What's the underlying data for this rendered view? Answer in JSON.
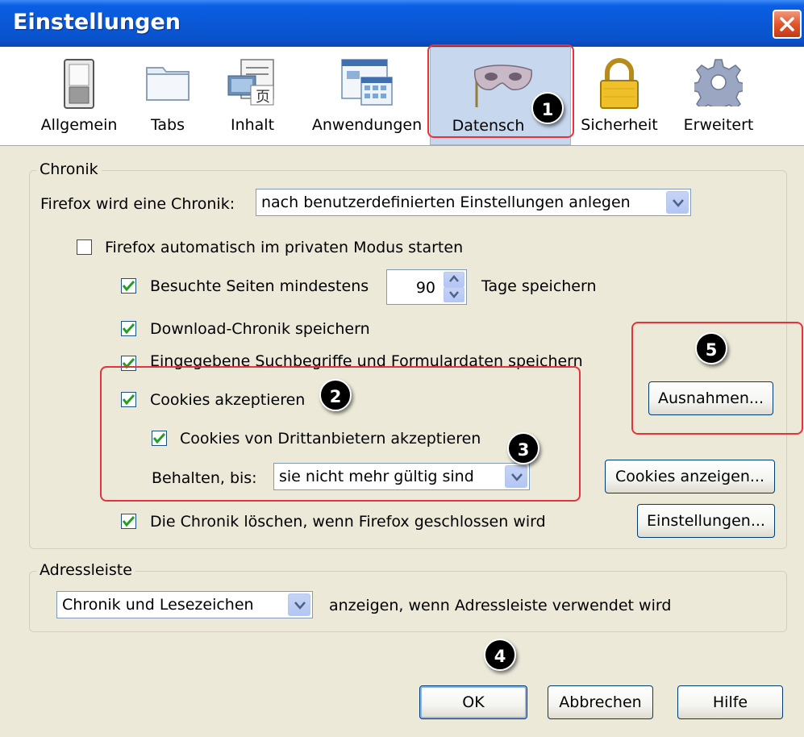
{
  "window": {
    "title": "Einstellungen"
  },
  "toolbar": {
    "panes": [
      {
        "label": "Allgemein",
        "icon": "switch-icon"
      },
      {
        "label": "Tabs",
        "icon": "folder-icon"
      },
      {
        "label": "Inhalt",
        "icon": "content-icon"
      },
      {
        "label": "Anwendungen",
        "icon": "applications-icon"
      },
      {
        "label": "Datensch",
        "icon": "mask-icon",
        "selected": true
      },
      {
        "label": "Sicherheit",
        "icon": "lock-icon"
      },
      {
        "label": "Erweitert",
        "icon": "gear-icon"
      }
    ]
  },
  "history": {
    "legend": "Chronik",
    "mode_label": "Firefox wird eine Chronik:",
    "mode_value": "nach benutzerdefinierten Einstellungen anlegen",
    "private_mode": {
      "label": "Firefox automatisch im privaten Modus starten",
      "checked": false
    },
    "visited": {
      "label": "Besuchte Seiten mindestens",
      "checked": true,
      "days": "90",
      "suffix": "Tage speichern"
    },
    "downloads": {
      "label": "Download-Chronik speichern",
      "checked": true
    },
    "search_forms": {
      "label": "Eingegebene Suchbegriffe und Formulardaten speichern",
      "checked": true
    },
    "cookies": {
      "label": "Cookies akzeptieren",
      "checked": true
    },
    "third_party": {
      "label": "Cookies von Drittanbietern akzeptieren",
      "checked": true
    },
    "keep_until": {
      "label": "Behalten, bis:",
      "value": "sie nicht mehr gültig sind"
    },
    "clear_on_close": {
      "label": "Die Chronik löschen, wenn Firefox geschlossen wird",
      "checked": true
    },
    "buttons": {
      "exceptions": "Ausnahmen...",
      "show_cookies": "Cookies anzeigen...",
      "settings": "Einstellungen..."
    }
  },
  "location_bar": {
    "legend": "Adressleiste",
    "value": "Chronik und Lesezeichen",
    "suffix": "anzeigen, wenn Adressleiste verwendet wird"
  },
  "footer": {
    "ok": "OK",
    "cancel": "Abbrechen",
    "help": "Hilfe"
  },
  "annotations": [
    "1",
    "2",
    "3",
    "4",
    "5"
  ],
  "colors": {
    "annotation_red": "#e8323b",
    "title_blue": "#0a58d6",
    "dialog_bg": "#ece9d8",
    "check_green": "#21a121"
  }
}
